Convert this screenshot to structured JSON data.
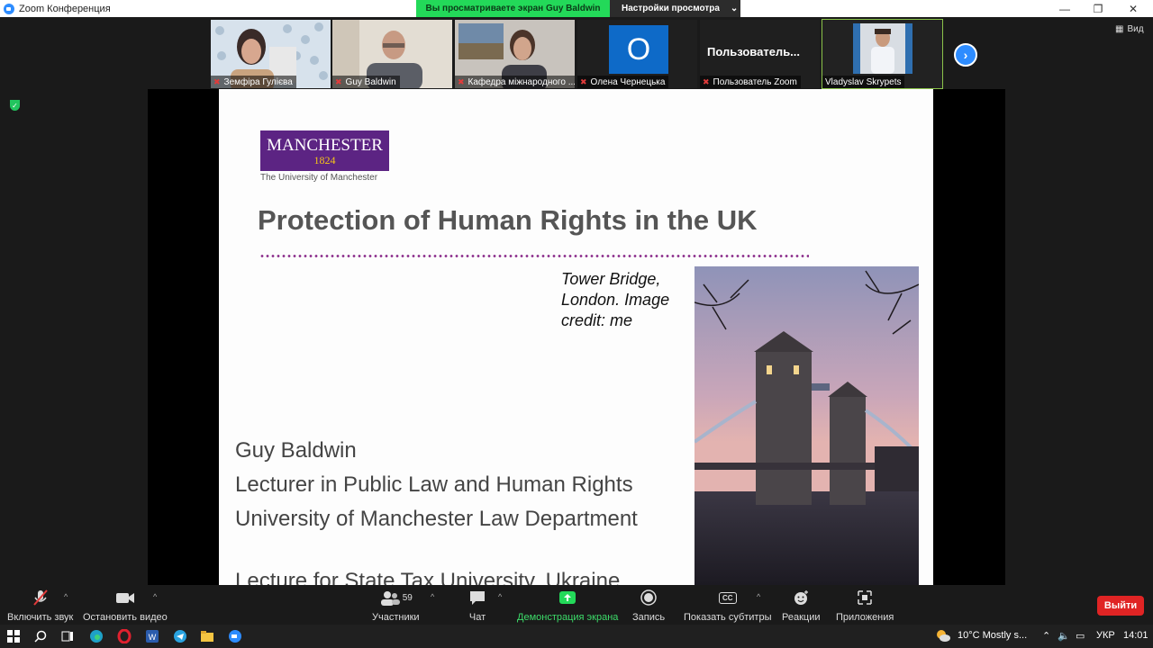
{
  "window": {
    "title": "Zoom Конференция",
    "minimize": "—",
    "maximize": "❐",
    "close": "✕"
  },
  "share_banner": {
    "viewing": "Вы просматриваете экран Guy Baldwin",
    "settings": "Настройки просмотра",
    "settings_caret": "⌄"
  },
  "participants": [
    {
      "name": "Земфіра Гулієва",
      "muted": true
    },
    {
      "name": "Guy Baldwin",
      "muted": true
    },
    {
      "name": "Кафедра міжнародного ...",
      "muted": true
    },
    {
      "name": "Олена Чернецька",
      "muted": true,
      "avatar_letter": "O"
    },
    {
      "name": "Пользователь Zoom",
      "muted": true,
      "display_text": "Пользователь..."
    },
    {
      "name": "Vladyslav Skrypets",
      "muted": false
    }
  ],
  "view_label": "Вид",
  "slide": {
    "logo_main": "MANCHESTER",
    "logo_year": "1824",
    "logo_sub": "The University of Manchester",
    "title": "Protection of Human Rights in the UK",
    "caption": "Tower Bridge, London. Image credit: me",
    "author_lines": [
      "Guy Baldwin",
      "Lecturer in Public Law and Human Rights",
      "University of Manchester Law Department"
    ],
    "last_line": "Lecture for State Tax University, Ukraine"
  },
  "toolbar": {
    "mute": "Включить звук",
    "video": "Остановить видео",
    "participants": "Участники",
    "participants_count": "59",
    "chat": "Чат",
    "share": "Демонстрация экрана",
    "record": "Запись",
    "subtitles": "Показать субтитры",
    "subtitles_icon": "CC",
    "reactions": "Реакции",
    "apps": "Приложения",
    "leave": "Выйти"
  },
  "taskbar": {
    "weather": "10°C  Mostly s...",
    "lang": "УКР",
    "time": "14:01"
  },
  "colors": {
    "zoom_blue": "#2d8cff",
    "green": "#23d959",
    "leave_red": "#e02424",
    "manchester_purple": "#5c2483"
  }
}
